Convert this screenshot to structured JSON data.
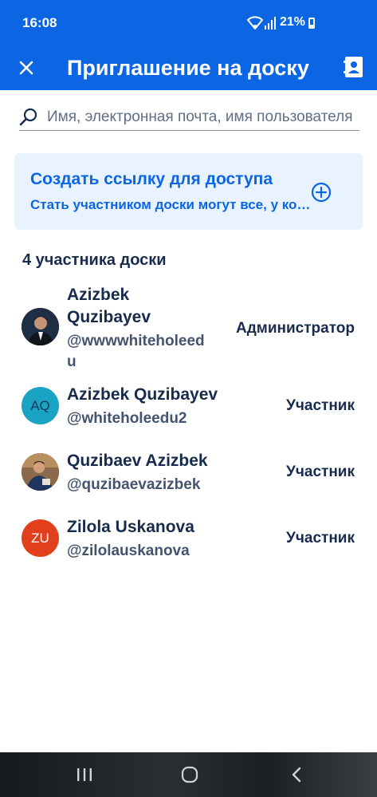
{
  "status": {
    "time": "16:08",
    "battery": "21%"
  },
  "header": {
    "title": "Приглашение на доску",
    "close_icon": "close-icon",
    "contacts_icon": "contact-book-icon"
  },
  "search": {
    "placeholder": "Имя, электронная почта, имя пользователя",
    "value": ""
  },
  "invite_link": {
    "title": "Создать ссылку для доступа",
    "subtitle": "Стать участником доски могут все, у кого есть ссылка",
    "icon": "add-circle-icon"
  },
  "members": {
    "header": "4 участника доски",
    "list": [
      {
        "name": "Azizbek\nQuzibayev",
        "username": "@wwwwhiteholeed\nu",
        "role": "Администратор",
        "avatar": "photo"
      },
      {
        "name": "Azizbek Quzibayev",
        "username": "@whiteholeedu2",
        "role": "Участник",
        "initials": "AQ",
        "color": "#1ba3c3"
      },
      {
        "name": "Quzibaev Azizbek",
        "username": "@quzibaevazizbek",
        "role": "Участник",
        "avatar": "photo"
      },
      {
        "name": "Zilola Uskanova",
        "username": "@zilolauskanova",
        "role": "Участник",
        "initials": "ZU",
        "color": "#e2401c"
      }
    ]
  },
  "colors": {
    "brand": "#0c66e4",
    "card_bg": "#e9f2ff",
    "text": "#172b4d",
    "subtle": "#44546f"
  }
}
